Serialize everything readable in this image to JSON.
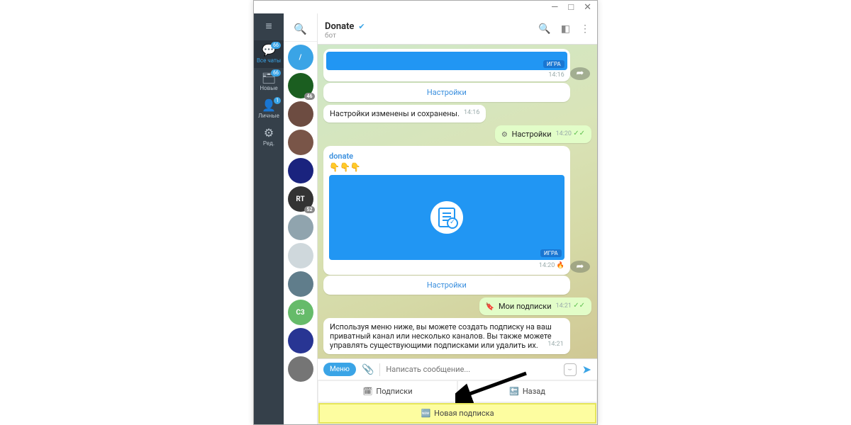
{
  "window": {
    "min": "—",
    "max": "□",
    "close": "✕"
  },
  "left_tabs": {
    "all": {
      "label": "Все чаты",
      "badge": "66"
    },
    "new": {
      "label": "Новые",
      "badge": "66"
    },
    "personal": {
      "label": "Личные",
      "badge": "1"
    },
    "edit": {
      "label": "Ред."
    }
  },
  "chat_list": {
    "active": {
      "label": "/",
      "color": "#3aa4e6"
    },
    "items": [
      {
        "color": "#1b5e20",
        "badge": "46"
      },
      {
        "color": "#6d4c41"
      },
      {
        "color": "#795548"
      },
      {
        "color": "#1a237e"
      },
      {
        "label": "RT",
        "color": "#333",
        "badge": "52"
      },
      {
        "color": "#90a4ae"
      },
      {
        "color": "#cfd8dc"
      },
      {
        "color": "#607d8b"
      },
      {
        "label": "С3",
        "color": "#66bb6a"
      },
      {
        "color": "#283593"
      },
      {
        "color": "#757575"
      }
    ]
  },
  "header": {
    "title": "Donate",
    "subtitle": "бот"
  },
  "messages": {
    "top_tag": "ИГРА",
    "top_time": "14:16",
    "kb1": "Настройки",
    "saved": {
      "text": "Настройки изменены и сохранены.",
      "time": "14:16"
    },
    "u1": {
      "text": "Настройки",
      "time": "14:20"
    },
    "card": {
      "title": "donate",
      "emojis": "👇👇👇",
      "tag": "ИГРА",
      "time": "14:20"
    },
    "kb2": "Настройки",
    "u2": {
      "text": "Мои подписки",
      "time": "14:21"
    },
    "info": {
      "text": "Используя меню ниже, вы можете создать подписку на ваш приватный канал или несколько каналов. Вы также можете управлять существующими подписками или удалить их.",
      "time": "14:21"
    }
  },
  "input": {
    "menu": "Меню",
    "placeholder": "Написать сообщение..."
  },
  "bottom_kb": {
    "subs": "Подписки",
    "back": "Назад",
    "newsub": "Новая подписка"
  }
}
